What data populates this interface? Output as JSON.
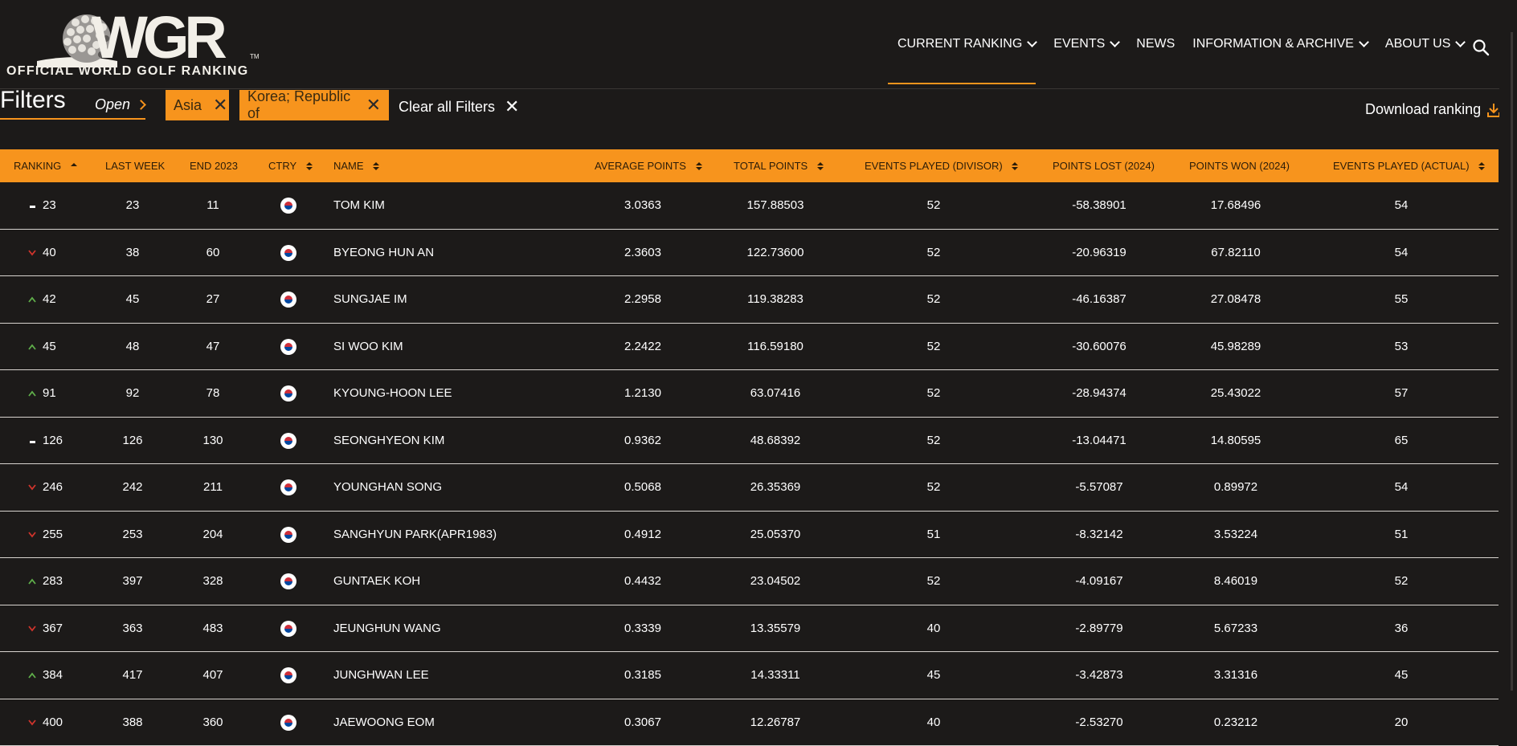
{
  "brand": {
    "logo_letters": "WGR",
    "logo_tm": "TM",
    "logo_subtitle": "OFFICIAL WORLD GOLF RANKING"
  },
  "nav": {
    "items": [
      {
        "label": "CURRENT RANKING",
        "dropdown": true
      },
      {
        "label": "EVENTS",
        "dropdown": true
      },
      {
        "label": "NEWS",
        "dropdown": false
      },
      {
        "label": "INFORMATION & ARCHIVE",
        "dropdown": true
      },
      {
        "label": "ABOUT US",
        "dropdown": true
      }
    ],
    "search_icon": "search-icon"
  },
  "filters": {
    "title": "Filters",
    "open_label": "Open",
    "chips": [
      "Asia",
      "Korea; Republic of"
    ],
    "clear_all_label": "Clear all Filters",
    "download_label": "Download ranking"
  },
  "colors": {
    "accent": "#f7941d",
    "background": "#1c1a19",
    "up": "#5fae4a",
    "down": "#d0342c"
  },
  "table": {
    "headers": [
      "RANKING",
      "LAST WEEK",
      "END 2023",
      "CTRY",
      "NAME",
      "AVERAGE POINTS",
      "TOTAL POINTS",
      "EVENTS PLAYED (DIVISOR)",
      "POINTS LOST (2024)",
      "POINTS WON (2024)",
      "EVENTS PLAYED (ACTUAL)"
    ],
    "rows": [
      {
        "move": "same",
        "ranking": "23",
        "last_week": "23",
        "end_2023": "11",
        "name": "TOM KIM",
        "avg": "3.0363",
        "total": "157.88503",
        "divisor": "52",
        "lost": "-58.38901",
        "won": "17.68496",
        "actual": "54"
      },
      {
        "move": "down",
        "ranking": "40",
        "last_week": "38",
        "end_2023": "60",
        "name": "BYEONG HUN AN",
        "avg": "2.3603",
        "total": "122.73600",
        "divisor": "52",
        "lost": "-20.96319",
        "won": "67.82110",
        "actual": "54"
      },
      {
        "move": "up",
        "ranking": "42",
        "last_week": "45",
        "end_2023": "27",
        "name": "SUNGJAE IM",
        "avg": "2.2958",
        "total": "119.38283",
        "divisor": "52",
        "lost": "-46.16387",
        "won": "27.08478",
        "actual": "55"
      },
      {
        "move": "up",
        "ranking": "45",
        "last_week": "48",
        "end_2023": "47",
        "name": "SI WOO KIM",
        "avg": "2.2422",
        "total": "116.59180",
        "divisor": "52",
        "lost": "-30.60076",
        "won": "45.98289",
        "actual": "53"
      },
      {
        "move": "up",
        "ranking": "91",
        "last_week": "92",
        "end_2023": "78",
        "name": "KYOUNG-HOON LEE",
        "avg": "1.2130",
        "total": "63.07416",
        "divisor": "52",
        "lost": "-28.94374",
        "won": "25.43022",
        "actual": "57"
      },
      {
        "move": "same",
        "ranking": "126",
        "last_week": "126",
        "end_2023": "130",
        "name": "SEONGHYEON KIM",
        "avg": "0.9362",
        "total": "48.68392",
        "divisor": "52",
        "lost": "-13.04471",
        "won": "14.80595",
        "actual": "65"
      },
      {
        "move": "down",
        "ranking": "246",
        "last_week": "242",
        "end_2023": "211",
        "name": "YOUNGHAN SONG",
        "avg": "0.5068",
        "total": "26.35369",
        "divisor": "52",
        "lost": "-5.57087",
        "won": "0.89972",
        "actual": "54"
      },
      {
        "move": "down",
        "ranking": "255",
        "last_week": "253",
        "end_2023": "204",
        "name": "SANGHYUN PARK(APR1983)",
        "avg": "0.4912",
        "total": "25.05370",
        "divisor": "51",
        "lost": "-8.32142",
        "won": "3.53224",
        "actual": "51"
      },
      {
        "move": "up",
        "ranking": "283",
        "last_week": "397",
        "end_2023": "328",
        "name": "GUNTAEK KOH",
        "avg": "0.4432",
        "total": "23.04502",
        "divisor": "52",
        "lost": "-4.09167",
        "won": "8.46019",
        "actual": "52"
      },
      {
        "move": "down",
        "ranking": "367",
        "last_week": "363",
        "end_2023": "483",
        "name": "JEUNGHUN WANG",
        "avg": "0.3339",
        "total": "13.35579",
        "divisor": "40",
        "lost": "-2.89779",
        "won": "5.67233",
        "actual": "36"
      },
      {
        "move": "up",
        "ranking": "384",
        "last_week": "417",
        "end_2023": "407",
        "name": "JUNGHWAN LEE",
        "avg": "0.3185",
        "total": "14.33311",
        "divisor": "45",
        "lost": "-3.42873",
        "won": "3.31316",
        "actual": "45"
      },
      {
        "move": "down",
        "ranking": "400",
        "last_week": "388",
        "end_2023": "360",
        "name": "JAEWOONG EOM",
        "avg": "0.3067",
        "total": "12.26787",
        "divisor": "40",
        "lost": "-2.53270",
        "won": "0.23212",
        "actual": "20"
      }
    ]
  }
}
